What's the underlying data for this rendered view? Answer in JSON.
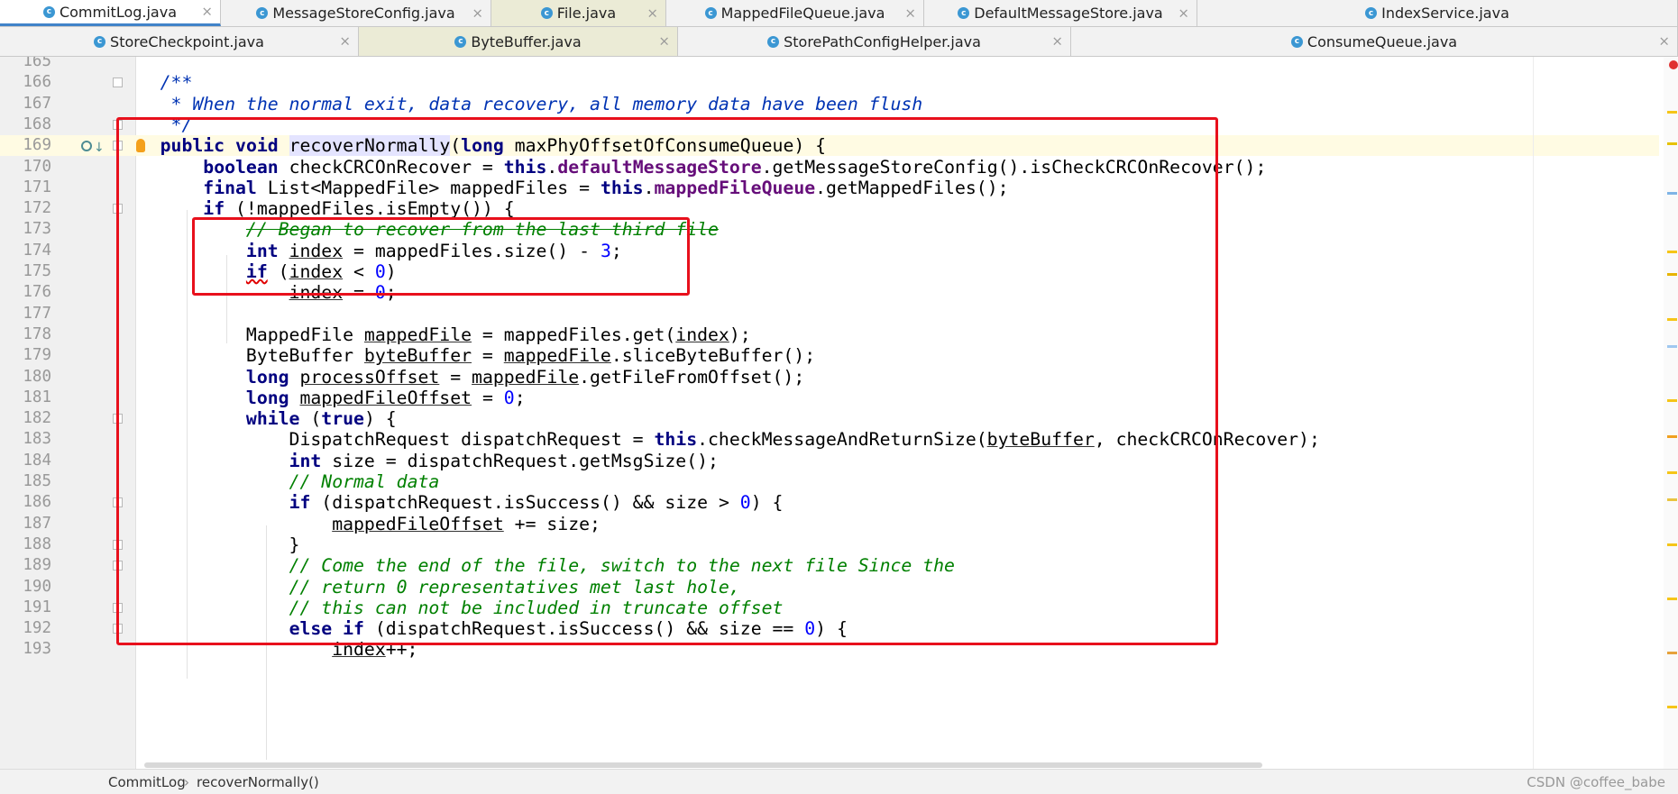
{
  "tabs_row1": [
    {
      "label": "CommitLog.java",
      "active": true
    },
    {
      "label": "MessageStoreConfig.java"
    },
    {
      "label": "File.java",
      "pinned": true
    },
    {
      "label": "MappedFileQueue.java"
    },
    {
      "label": "DefaultMessageStore.java"
    },
    {
      "label": "IndexService.java"
    }
  ],
  "tabs_row2": [
    {
      "label": "StoreCheckpoint.java"
    },
    {
      "label": "ByteBuffer.java",
      "pinned": true
    },
    {
      "label": "StorePathConfigHelper.java"
    },
    {
      "label": "ConsumeQueue.java"
    }
  ],
  "close_glyph": "×",
  "class_icon_letter": "c",
  "current_line": 169,
  "code_lines": [
    {
      "n": "165",
      "text": ""
    },
    {
      "n": "166",
      "text": "    /**"
    },
    {
      "n": "167",
      "text": "     * When the normal exit, data recovery, all memory data have been flush"
    },
    {
      "n": "168",
      "text": "     */"
    },
    {
      "n": "169",
      "text": "    public void recoverNormally(long maxPhyOffsetOfConsumeQueue) {"
    },
    {
      "n": "170",
      "text": "        boolean checkCRCOnRecover = this.defaultMessageStore.getMessageStoreConfig().isCheckCRCOnRecover();"
    },
    {
      "n": "171",
      "text": "        final List<MappedFile> mappedFiles = this.mappedFileQueue.getMappedFiles();"
    },
    {
      "n": "172",
      "text": "        if (!mappedFiles.isEmpty()) {"
    },
    {
      "n": "173",
      "text": "            // Began to recover from the last third file"
    },
    {
      "n": "174",
      "text": "            int index = mappedFiles.size() - 3;"
    },
    {
      "n": "175",
      "text": "            if (index < 0)"
    },
    {
      "n": "176",
      "text": "                index = 0;"
    },
    {
      "n": "177",
      "text": ""
    },
    {
      "n": "178",
      "text": "            MappedFile mappedFile = mappedFiles.get(index);"
    },
    {
      "n": "179",
      "text": "            ByteBuffer byteBuffer = mappedFile.sliceByteBuffer();"
    },
    {
      "n": "180",
      "text": "            long processOffset = mappedFile.getFileFromOffset();"
    },
    {
      "n": "181",
      "text": "            long mappedFileOffset = 0;"
    },
    {
      "n": "182",
      "text": "            while (true) {"
    },
    {
      "n": "183",
      "text": "                DispatchRequest dispatchRequest = this.checkMessageAndReturnSize(byteBuffer, checkCRCOnRecover);"
    },
    {
      "n": "184",
      "text": "                int size = dispatchRequest.getMsgSize();"
    },
    {
      "n": "185",
      "text": "                // Normal data"
    },
    {
      "n": "186",
      "text": "                if (dispatchRequest.isSuccess() && size > 0) {"
    },
    {
      "n": "187",
      "text": "                    mappedFileOffset += size;"
    },
    {
      "n": "188",
      "text": "                }"
    },
    {
      "n": "189",
      "text": "                // Come the end of the file, switch to the next file Since the"
    },
    {
      "n": "190",
      "text": "                // return 0 representatives met last hole,"
    },
    {
      "n": "191",
      "text": "                // this can not be included in truncate offset"
    },
    {
      "n": "192",
      "text": "                else if (dispatchRequest.isSuccess() && size == 0) {"
    },
    {
      "n": "193",
      "text": "                    index++;"
    }
  ],
  "breadcrumb": {
    "class_name": "CommitLog",
    "separator": "›",
    "method": "recoverNormally()"
  },
  "watermark": "CSDN @coffee_babe",
  "colors": {
    "highlight_box": "#e8101c",
    "keyword": "#000080",
    "field": "#660e7a",
    "number": "#0000ff",
    "comment": "#008000",
    "doc_comment": "#0033b3"
  }
}
